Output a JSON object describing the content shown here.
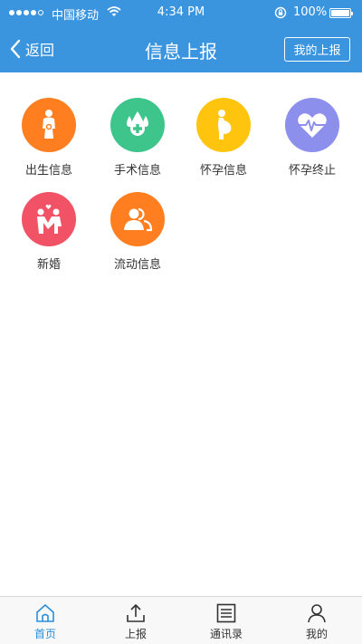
{
  "status_bar": {
    "carrier": "中国移动",
    "time": "4:34 PM",
    "battery": "100%",
    "signal_bars_filled": 4,
    "signal_bars_total": 5
  },
  "nav": {
    "back_label": "返回",
    "title": "信息上报",
    "action_label": "我的上报"
  },
  "menu": [
    {
      "label": "出生信息",
      "color": "#ff7e1f",
      "icon": "mother-baby-icon"
    },
    {
      "label": "手术信息",
      "color": "#3dc58c",
      "icon": "blood-drop-cross-icon"
    },
    {
      "label": "怀孕信息",
      "color": "#ffc50e",
      "icon": "pregnant-woman-icon"
    },
    {
      "label": "怀孕终止",
      "color": "#8c8fec",
      "icon": "heartbeat-icon"
    },
    {
      "label": "新婚",
      "color": "#f25266",
      "icon": "newlywed-couple-icon"
    },
    {
      "label": "流动信息",
      "color": "#ff7e1f",
      "icon": "people-group-icon"
    }
  ],
  "tabs": [
    {
      "label": "首页",
      "icon": "home-icon",
      "active": true
    },
    {
      "label": "上报",
      "icon": "upload-icon",
      "active": false
    },
    {
      "label": "通讯录",
      "icon": "contacts-list-icon",
      "active": false
    },
    {
      "label": "我的",
      "icon": "user-icon",
      "active": false
    }
  ],
  "colors": {
    "nav_background": "#3b94de",
    "tab_active": "#2a8fd8"
  }
}
